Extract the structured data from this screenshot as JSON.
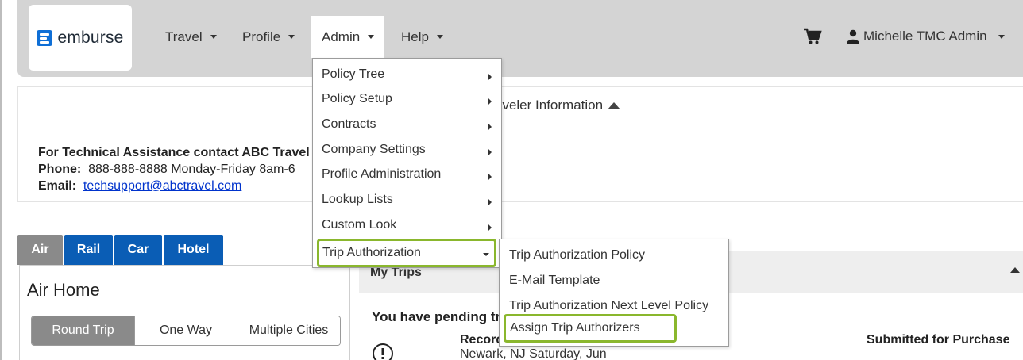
{
  "brand": {
    "logo_text": "emburse",
    "accent": "#0f6fd6"
  },
  "nav": {
    "travel": "Travel",
    "profile": "Profile",
    "admin": "Admin",
    "help": "Help",
    "user": "Michelle TMC Admin"
  },
  "info": {
    "heading": "aveler Information",
    "line1": "For Technical Assistance contact ABC Travel",
    "phone_label": "Phone:",
    "phone_value": "888-888-8888 Monday-Friday 8am-6",
    "email_label": "Email:",
    "email_value": "techsupport@abctravel.com"
  },
  "tabs": [
    "Air",
    "Rail",
    "Car",
    "Hotel"
  ],
  "air": {
    "title": "Air Home",
    "trip_types": [
      "Round Trip",
      "One Way",
      "Multiple Cities"
    ]
  },
  "trips": {
    "title": "My Trips",
    "pending": "You have pending tri",
    "record": "Record",
    "record_sub": "Newark, NJ Saturday, Jun",
    "status": "Submitted for Purchase"
  },
  "admin_menu": {
    "items": [
      "Policy Tree",
      "Policy Setup",
      "Contracts",
      "Company Settings",
      "Profile Administration",
      "Lookup Lists",
      "Custom Look",
      "Trip Authorization"
    ]
  },
  "trip_auth_menu": {
    "items": [
      "Trip Authorization Policy",
      "E-Mail Template",
      "Trip Authorization Next Level Policy",
      "Assign Trip Authorizers"
    ]
  },
  "highlight_color": "#8ab72d"
}
